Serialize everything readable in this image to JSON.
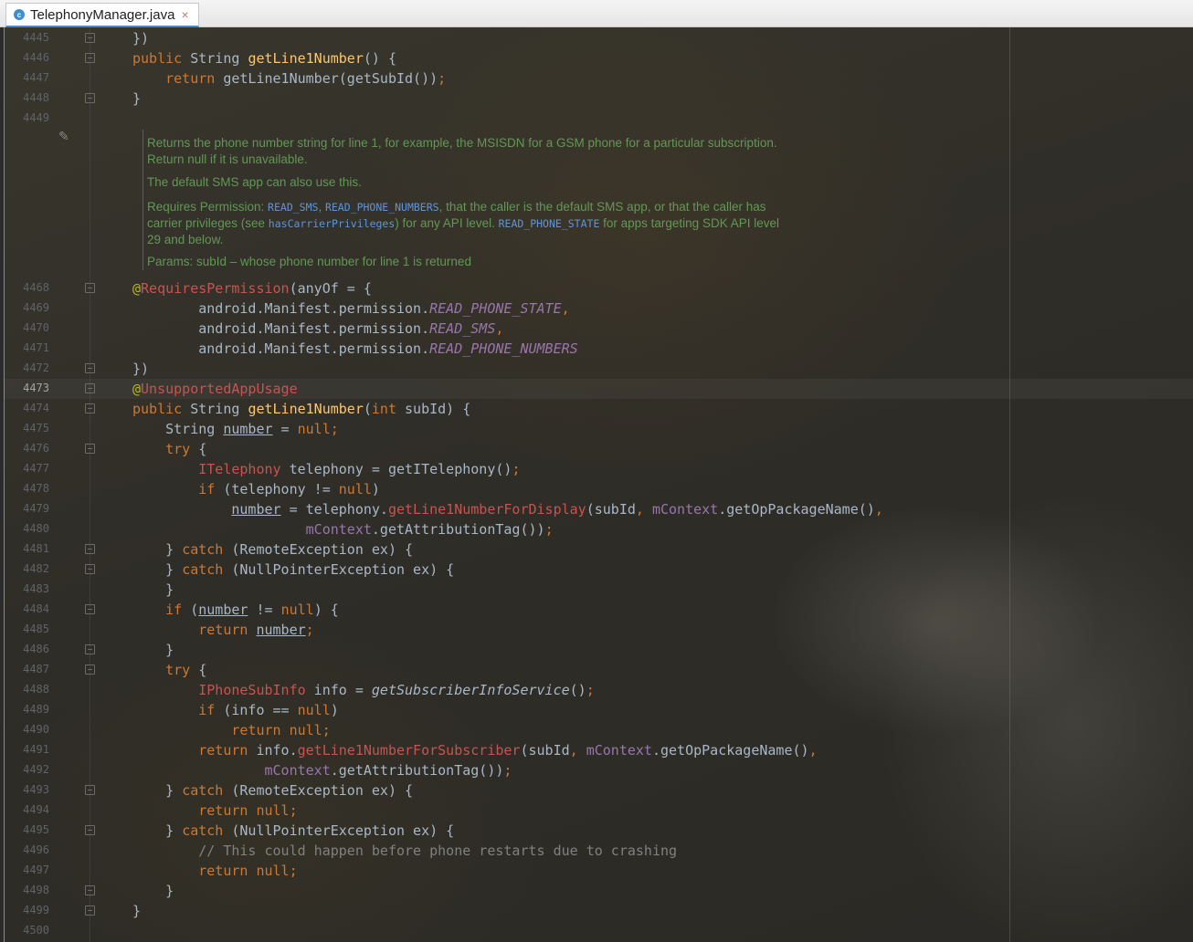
{
  "tab": {
    "icon": "c",
    "title": "TelephonyManager.java",
    "close": "×"
  },
  "current_line": "4473",
  "lines_top": [
    {
      "n": "4445",
      "fold": true,
      "t": [
        [
          "",
          "})"
        ]
      ]
    },
    {
      "n": "4446",
      "fold": true,
      "t": [
        [
          "kw",
          "public "
        ],
        [
          "",
          "String "
        ],
        [
          "fn",
          "getLine1Number"
        ],
        [
          "",
          "() {"
        ]
      ]
    },
    {
      "n": "4447",
      "fold": false,
      "t": [
        [
          "",
          "    "
        ],
        [
          "kw",
          "return "
        ],
        [
          "",
          "getLine1Number(getSubId())"
        ],
        [
          "kw",
          ";"
        ]
      ]
    },
    {
      "n": "4448",
      "fold": true,
      "t": [
        [
          "",
          "}"
        ]
      ]
    },
    {
      "n": "4449",
      "fold": false,
      "t": []
    }
  ],
  "doc": {
    "p1": "Returns the phone number string for line 1, for example, the MSISDN for a GSM phone for a particular subscription. Return null if it is unavailable.",
    "p2": "The default SMS app can also use this.",
    "p3": [
      [
        "t",
        "Requires Permission: "
      ],
      [
        "c",
        "READ_SMS"
      ],
      [
        "t",
        ", "
      ],
      [
        "c",
        "READ_PHONE_NUMBERS"
      ],
      [
        "t",
        ", that the caller is the default SMS app, or that the caller has carrier privileges (see "
      ],
      [
        "c",
        "hasCarrierPrivileges"
      ],
      [
        "t",
        ") for any API level. "
      ],
      [
        "c",
        "READ_PHONE_STATE"
      ],
      [
        "t",
        " for apps targeting SDK API level 29 and below."
      ]
    ],
    "p4": "Params: subId – whose phone number for line 1 is returned"
  },
  "lines_bottom": [
    {
      "n": "4468",
      "fold": true,
      "t": [
        [
          "an",
          "@"
        ],
        [
          "er",
          "RequiresPermission"
        ],
        [
          "",
          "(anyOf = {"
        ]
      ]
    },
    {
      "n": "4469",
      "fold": false,
      "t": [
        [
          "",
          "        android.Manifest.permission."
        ],
        [
          "pi",
          "READ_PHONE_STATE"
        ],
        [
          "kw",
          ","
        ]
      ]
    },
    {
      "n": "4470",
      "fold": false,
      "t": [
        [
          "",
          "        android.Manifest.permission."
        ],
        [
          "pi",
          "READ_SMS"
        ],
        [
          "kw",
          ","
        ]
      ]
    },
    {
      "n": "4471",
      "fold": false,
      "t": [
        [
          "",
          "        android.Manifest.permission."
        ],
        [
          "pi",
          "READ_PHONE_NUMBERS"
        ]
      ]
    },
    {
      "n": "4472",
      "fold": true,
      "t": [
        [
          "",
          "})"
        ]
      ]
    },
    {
      "n": "4473",
      "fold": true,
      "t": [
        [
          "an",
          "@"
        ],
        [
          "er",
          "UnsupportedAppUsage"
        ]
      ]
    },
    {
      "n": "4474",
      "fold": true,
      "t": [
        [
          "kw",
          "public "
        ],
        [
          "",
          "String "
        ],
        [
          "fn",
          "getLine1Number"
        ],
        [
          "",
          "("
        ],
        [
          "kw",
          "int "
        ],
        [
          "",
          "subId) {"
        ]
      ]
    },
    {
      "n": "4475",
      "fold": false,
      "t": [
        [
          "",
          "    String "
        ],
        [
          "ul",
          "number"
        ],
        [
          "",
          " = "
        ],
        [
          "kw",
          "null;"
        ]
      ]
    },
    {
      "n": "4476",
      "fold": true,
      "t": [
        [
          "",
          "    "
        ],
        [
          "kw",
          "try "
        ],
        [
          "",
          "{"
        ]
      ]
    },
    {
      "n": "4477",
      "fold": false,
      "t": [
        [
          "",
          "        "
        ],
        [
          "er",
          "ITelephony"
        ],
        [
          "",
          " telephony = getITelephony()"
        ],
        [
          "kw",
          ";"
        ]
      ]
    },
    {
      "n": "4478",
      "fold": false,
      "t": [
        [
          "",
          "        "
        ],
        [
          "kw",
          "if "
        ],
        [
          "",
          "(telephony != "
        ],
        [
          "kw",
          "null"
        ],
        [
          "",
          ")"
        ]
      ]
    },
    {
      "n": "4479",
      "fold": false,
      "t": [
        [
          "",
          "            "
        ],
        [
          "ul",
          "number"
        ],
        [
          "",
          " = telephony."
        ],
        [
          "er",
          "getLine1NumberForDisplay"
        ],
        [
          "",
          "(subId"
        ],
        [
          "kw",
          ", "
        ],
        [
          "pf",
          "mContext"
        ],
        [
          "",
          ".getOpPackageName()"
        ],
        [
          "kw",
          ","
        ]
      ]
    },
    {
      "n": "4480",
      "fold": false,
      "t": [
        [
          "",
          "                     "
        ],
        [
          "pf",
          "mContext"
        ],
        [
          "",
          ".getAttributionTag())"
        ],
        [
          "kw",
          ";"
        ]
      ]
    },
    {
      "n": "4481",
      "fold": true,
      "t": [
        [
          "",
          "    } "
        ],
        [
          "kw",
          "catch "
        ],
        [
          "",
          "(RemoteException ex) {"
        ]
      ]
    },
    {
      "n": "4482",
      "fold": true,
      "t": [
        [
          "",
          "    } "
        ],
        [
          "kw",
          "catch "
        ],
        [
          "",
          "(NullPointerException ex) {"
        ]
      ]
    },
    {
      "n": "4483",
      "fold": false,
      "t": [
        [
          "",
          "    }"
        ]
      ]
    },
    {
      "n": "4484",
      "fold": true,
      "t": [
        [
          "",
          "    "
        ],
        [
          "kw",
          "if "
        ],
        [
          "",
          "("
        ],
        [
          "ul",
          "number"
        ],
        [
          "",
          " != "
        ],
        [
          "kw",
          "null"
        ],
        [
          "",
          ") {"
        ]
      ]
    },
    {
      "n": "4485",
      "fold": false,
      "t": [
        [
          "",
          "        "
        ],
        [
          "kw",
          "return "
        ],
        [
          "ul",
          "number"
        ],
        [
          "kw",
          ";"
        ]
      ]
    },
    {
      "n": "4486",
      "fold": true,
      "t": [
        [
          "",
          "    }"
        ]
      ]
    },
    {
      "n": "4487",
      "fold": true,
      "t": [
        [
          "",
          "    "
        ],
        [
          "kw",
          "try "
        ],
        [
          "",
          "{"
        ]
      ]
    },
    {
      "n": "4488",
      "fold": false,
      "t": [
        [
          "",
          "        "
        ],
        [
          "er",
          "IPhoneSubInfo"
        ],
        [
          "",
          " info = "
        ],
        [
          "si",
          "getSubscriberInfoService"
        ],
        [
          "",
          "()"
        ],
        [
          "kw",
          ";"
        ]
      ]
    },
    {
      "n": "4489",
      "fold": false,
      "t": [
        [
          "",
          "        "
        ],
        [
          "kw",
          "if "
        ],
        [
          "",
          "(info == "
        ],
        [
          "kw",
          "null"
        ],
        [
          "",
          ")"
        ]
      ]
    },
    {
      "n": "4490",
      "fold": false,
      "t": [
        [
          "",
          "            "
        ],
        [
          "kw",
          "return "
        ],
        [
          "kw",
          "null;"
        ]
      ]
    },
    {
      "n": "4491",
      "fold": false,
      "t": [
        [
          "",
          "        "
        ],
        [
          "kw",
          "return "
        ],
        [
          "",
          "info."
        ],
        [
          "er",
          "getLine1NumberForSubscriber"
        ],
        [
          "",
          "(subId"
        ],
        [
          "kw",
          ", "
        ],
        [
          "pf",
          "mContext"
        ],
        [
          "",
          ".getOpPackageName()"
        ],
        [
          "kw",
          ","
        ]
      ]
    },
    {
      "n": "4492",
      "fold": false,
      "t": [
        [
          "",
          "                "
        ],
        [
          "pf",
          "mContext"
        ],
        [
          "",
          ".getAttributionTag())"
        ],
        [
          "kw",
          ";"
        ]
      ]
    },
    {
      "n": "4493",
      "fold": true,
      "t": [
        [
          "",
          "    } "
        ],
        [
          "kw",
          "catch "
        ],
        [
          "",
          "(RemoteException ex) {"
        ]
      ]
    },
    {
      "n": "4494",
      "fold": false,
      "t": [
        [
          "",
          "        "
        ],
        [
          "kw",
          "return "
        ],
        [
          "kw",
          "null;"
        ]
      ]
    },
    {
      "n": "4495",
      "fold": true,
      "t": [
        [
          "",
          "    } "
        ],
        [
          "kw",
          "catch "
        ],
        [
          "",
          "(NullPointerException ex) {"
        ]
      ]
    },
    {
      "n": "4496",
      "fold": false,
      "t": [
        [
          "",
          "        "
        ],
        [
          "cm",
          "// This could happen before phone restarts due to crashing"
        ]
      ]
    },
    {
      "n": "4497",
      "fold": false,
      "t": [
        [
          "",
          "        "
        ],
        [
          "kw",
          "return "
        ],
        [
          "kw",
          "null;"
        ]
      ]
    },
    {
      "n": "4498",
      "fold": true,
      "t": [
        [
          "",
          "    }"
        ]
      ]
    },
    {
      "n": "4499",
      "fold": true,
      "t": [
        [
          "",
          "}"
        ]
      ]
    },
    {
      "n": "4500",
      "fold": false,
      "t": []
    }
  ]
}
